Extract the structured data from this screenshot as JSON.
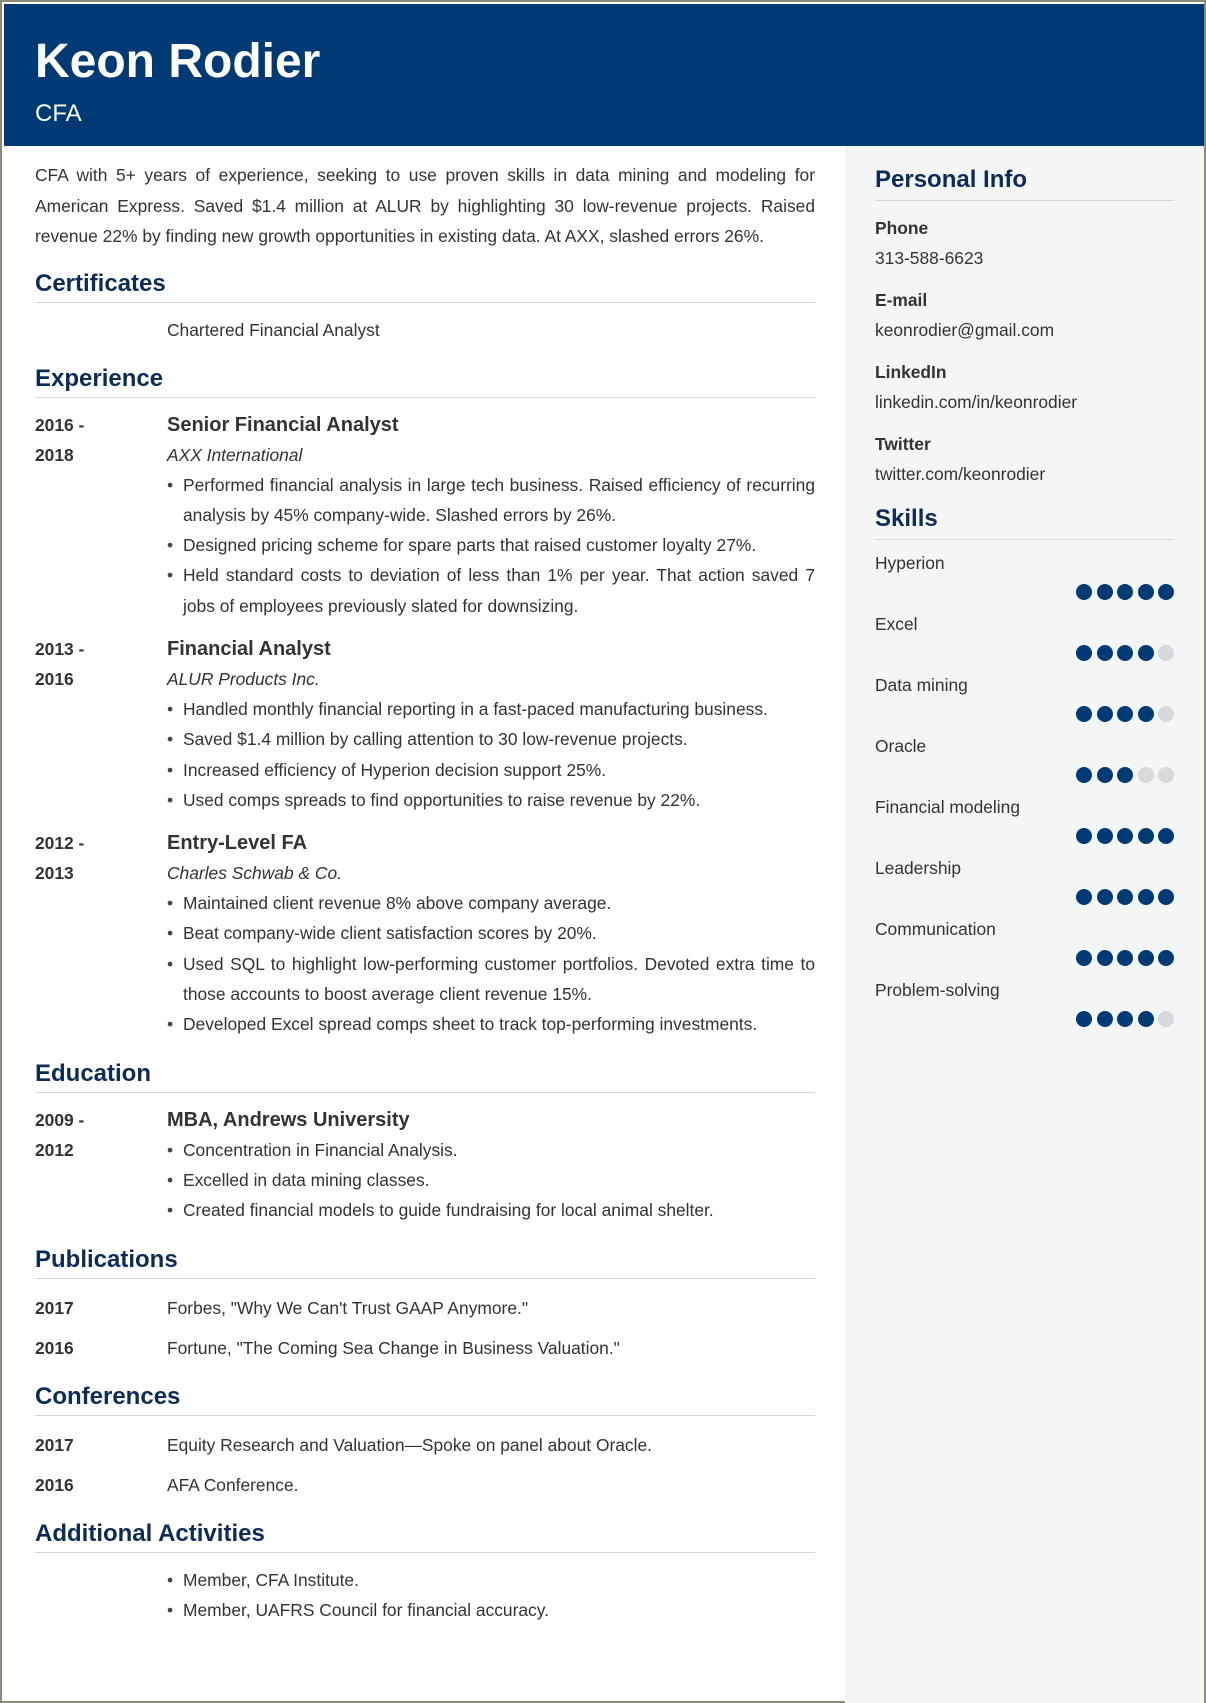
{
  "header": {
    "name": "Keon Rodier",
    "title": "CFA"
  },
  "summary": "CFA with 5+ years of experience, seeking to use proven skills in data mining and modeling for American Express. Saved $1.4 million at ALUR by highlighting 30 low-revenue projects. Raised revenue 22% by finding new growth opportunities in existing data. At AXX, slashed errors 26%.",
  "certificates": {
    "heading": "Certificates",
    "items": [
      "Chartered Financial Analyst"
    ]
  },
  "experience": {
    "heading": "Experience",
    "jobs": [
      {
        "date_start": "2016 -",
        "date_end": "2018",
        "title": "Senior Financial Analyst",
        "company": "AXX International",
        "bullets": [
          "Performed financial analysis in large tech business. Raised efficiency of recurring analysis by 45% company-wide. Slashed errors by 26%.",
          "Designed pricing scheme for spare parts that raised customer loyalty 27%.",
          "Held standard costs to deviation of less than 1% per year. That action saved 7 jobs of employees previously slated for downsizing."
        ]
      },
      {
        "date_start": "2013 -",
        "date_end": "2016",
        "title": "Financial Analyst",
        "company": "ALUR Products Inc.",
        "bullets": [
          "Handled monthly financial reporting in a fast-paced manufacturing business.",
          "Saved $1.4 million by calling attention to 30 low-revenue projects.",
          "Increased efficiency of Hyperion decision support 25%.",
          "Used comps spreads to find opportunities to raise revenue by 22%."
        ]
      },
      {
        "date_start": "2012 -",
        "date_end": "2013",
        "title": "Entry-Level FA",
        "company": "Charles Schwab & Co.",
        "bullets": [
          "Maintained client revenue 8% above company average.",
          "Beat company-wide client satisfaction scores by 20%.",
          "Used SQL to highlight low-performing customer portfolios. Devoted extra time to those accounts to boost average client revenue 15%.",
          "Developed Excel spread comps sheet to track top-performing investments."
        ]
      }
    ]
  },
  "education": {
    "heading": "Education",
    "entries": [
      {
        "date_start": "2009 -",
        "date_end": "2012",
        "title": "MBA, Andrews University",
        "bullets": [
          "Concentration in Financial Analysis.",
          "Excelled in data mining classes.",
          "Created financial models to guide fundraising for local animal shelter."
        ]
      }
    ]
  },
  "publications": {
    "heading": "Publications",
    "items": [
      {
        "year": "2017",
        "text": "Forbes, \"Why We Can't Trust GAAP Anymore.\""
      },
      {
        "year": "2016",
        "text": "Fortune, \"The Coming Sea Change in Business Valuation.\""
      }
    ]
  },
  "conferences": {
    "heading": "Conferences",
    "items": [
      {
        "year": "2017",
        "text": "Equity Research and Valuation—Spoke on panel about Oracle."
      },
      {
        "year": "2016",
        "text": "AFA Conference."
      }
    ]
  },
  "activities": {
    "heading": "Additional Activities",
    "items": [
      "Member, CFA Institute.",
      "Member, UAFRS Council for financial accuracy."
    ]
  },
  "sidebar": {
    "personal_info": {
      "heading": "Personal Info",
      "fields": [
        {
          "label": "Phone",
          "value": "313-588-6623"
        },
        {
          "label": "E-mail",
          "value": "keonrodier@gmail.com"
        },
        {
          "label": "LinkedIn",
          "value": "linkedin.com/in/keonrodier"
        },
        {
          "label": "Twitter",
          "value": "twitter.com/keonrodier"
        }
      ]
    },
    "skills": {
      "heading": "Skills",
      "max_rating": 5,
      "items": [
        {
          "name": "Hyperion",
          "rating": 5
        },
        {
          "name": "Excel",
          "rating": 4
        },
        {
          "name": "Data mining",
          "rating": 4
        },
        {
          "name": "Oracle",
          "rating": 3
        },
        {
          "name": "Financial modeling",
          "rating": 5
        },
        {
          "name": "Leadership",
          "rating": 5
        },
        {
          "name": "Communication",
          "rating": 5
        },
        {
          "name": "Problem-solving",
          "rating": 4
        }
      ]
    }
  },
  "colors": {
    "brand": "#003a75",
    "heading": "#0d2b57",
    "sidebar_bg": "#f4f6f6",
    "dot_empty": "#d6d8db"
  }
}
